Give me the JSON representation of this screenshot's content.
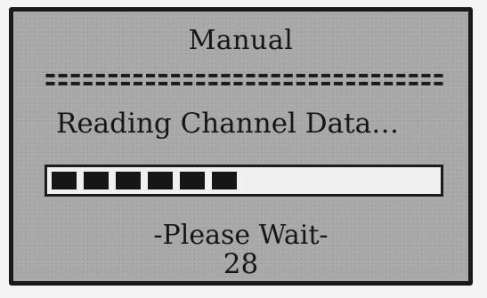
{
  "screen": {
    "title": "Manual",
    "divider_text": "================================",
    "status_text": "Reading Channel Data…",
    "progress": {
      "filled_segments": 6,
      "fraction": 0.37
    },
    "wait_text": "-Please Wait-",
    "counter": "28"
  },
  "colors": {
    "lcd_background": "#a8a8a8",
    "text": "#161616",
    "progress_track": "#f0f0f0",
    "progress_fill": "#161616"
  }
}
